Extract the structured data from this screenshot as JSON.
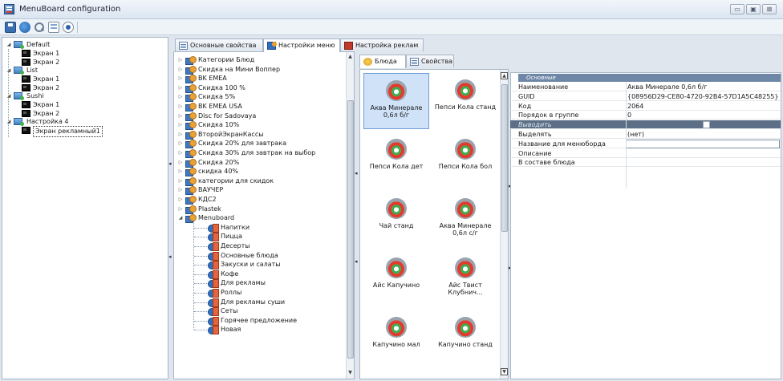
{
  "window": {
    "title": "MenuBoard configuration",
    "buttons": [
      "▭",
      "▣",
      "⊠"
    ]
  },
  "toolbar": {
    "icons": [
      "save-icon",
      "refresh-icon",
      "search-icon",
      "grid-icon",
      "record-icon"
    ]
  },
  "left_tree": [
    {
      "label": "Default",
      "type": "config"
    },
    {
      "label": "Экран 1",
      "type": "screen"
    },
    {
      "label": "Экран 2",
      "type": "screen"
    },
    {
      "label": "List",
      "type": "config"
    },
    {
      "label": "Экран 1",
      "type": "screen"
    },
    {
      "label": "Экран 2",
      "type": "screen"
    },
    {
      "label": "Sushi",
      "type": "config"
    },
    {
      "label": "Экран 1",
      "type": "screen"
    },
    {
      "label": "Экран 2",
      "type": "screen"
    },
    {
      "label": "Настройка 4",
      "type": "config"
    },
    {
      "label": "Экран рекламный1",
      "type": "screen",
      "selected": true
    }
  ],
  "top_tabs": [
    {
      "label": "Основные свойства",
      "icon": "properties-icon"
    },
    {
      "label": "Настройки меню",
      "icon": "menu-icon",
      "active": true
    },
    {
      "label": "Настройка реклам",
      "icon": "ads-icon"
    }
  ],
  "category_tree": [
    {
      "label": "Категории Блюд"
    },
    {
      "label": "Скидка на Мини Воппер"
    },
    {
      "label": "BK EMEA"
    },
    {
      "label": "Скидка 100 %"
    },
    {
      "label": "Скидка 5%"
    },
    {
      "label": "BK EMEA USA"
    },
    {
      "label": "Disc for Sadovaya"
    },
    {
      "label": "Скидка 10%"
    },
    {
      "label": "ВторойЭкранКассы"
    },
    {
      "label": "Скидка 20% для завтрака"
    },
    {
      "label": "Скидка 30% для завтрак на выбор"
    },
    {
      "label": "Скидка 20%"
    },
    {
      "label": "скидка 40%"
    },
    {
      "label": "категории для скидок"
    },
    {
      "label": "ВАУЧЕР"
    },
    {
      "label": "КДС2"
    },
    {
      "label": "Plastek"
    },
    {
      "label": "Menuboard",
      "expanded": true
    }
  ],
  "menuboard_children": [
    "Напитки",
    "Пицца",
    "Десерты",
    "Основные блюда",
    "Закуски и салаты",
    "Кофе",
    "Для рекламы",
    "Роллы",
    "Для рекламы суши",
    "Сеты",
    "Горячее предложение",
    "Новая"
  ],
  "inner_tabs": [
    {
      "label": "Блюда",
      "active": true,
      "icon": "dish-icon"
    },
    {
      "label": "Свойства",
      "icon": "properties-icon"
    }
  ],
  "dishes": [
    {
      "label": "Аква Минерале 0,6л б/г",
      "selected": true
    },
    {
      "label": "Пепси Кола станд"
    },
    {
      "label": "Пепси Кола дет"
    },
    {
      "label": "Пепси Кола бол"
    },
    {
      "label": "Чай станд"
    },
    {
      "label": "Аква Минерале 0,6л с/г"
    },
    {
      "label": "Айс Капучино"
    },
    {
      "label": "Айс Твист Клубнич..."
    },
    {
      "label": "Капучино мал"
    },
    {
      "label": "Капучино станд"
    }
  ],
  "properties": {
    "header": "Основные",
    "rows": [
      {
        "name": "Наименование",
        "value": "Аква Минерале 0,6л б/г"
      },
      {
        "name": "GUID",
        "value": "{08956D29-CE80-4720-92B4-57D1A5C48255}"
      },
      {
        "name": "Код",
        "value": "2064"
      },
      {
        "name": "Порядок в группе",
        "value": "0"
      },
      {
        "name": "Выводить",
        "value": "",
        "kind": "checkbox",
        "dark": true
      },
      {
        "name": "Выделять",
        "value": "(нет)"
      },
      {
        "name": "Название для менюборда",
        "value": "",
        "kind": "input"
      },
      {
        "name": "Описание",
        "value": ""
      },
      {
        "name": "В составе блюда",
        "value": ""
      }
    ]
  },
  "colors": {
    "prop_header": "#6e87a7",
    "selected_dish": "#cfe2f8",
    "title_bg": "#dae5f1"
  }
}
